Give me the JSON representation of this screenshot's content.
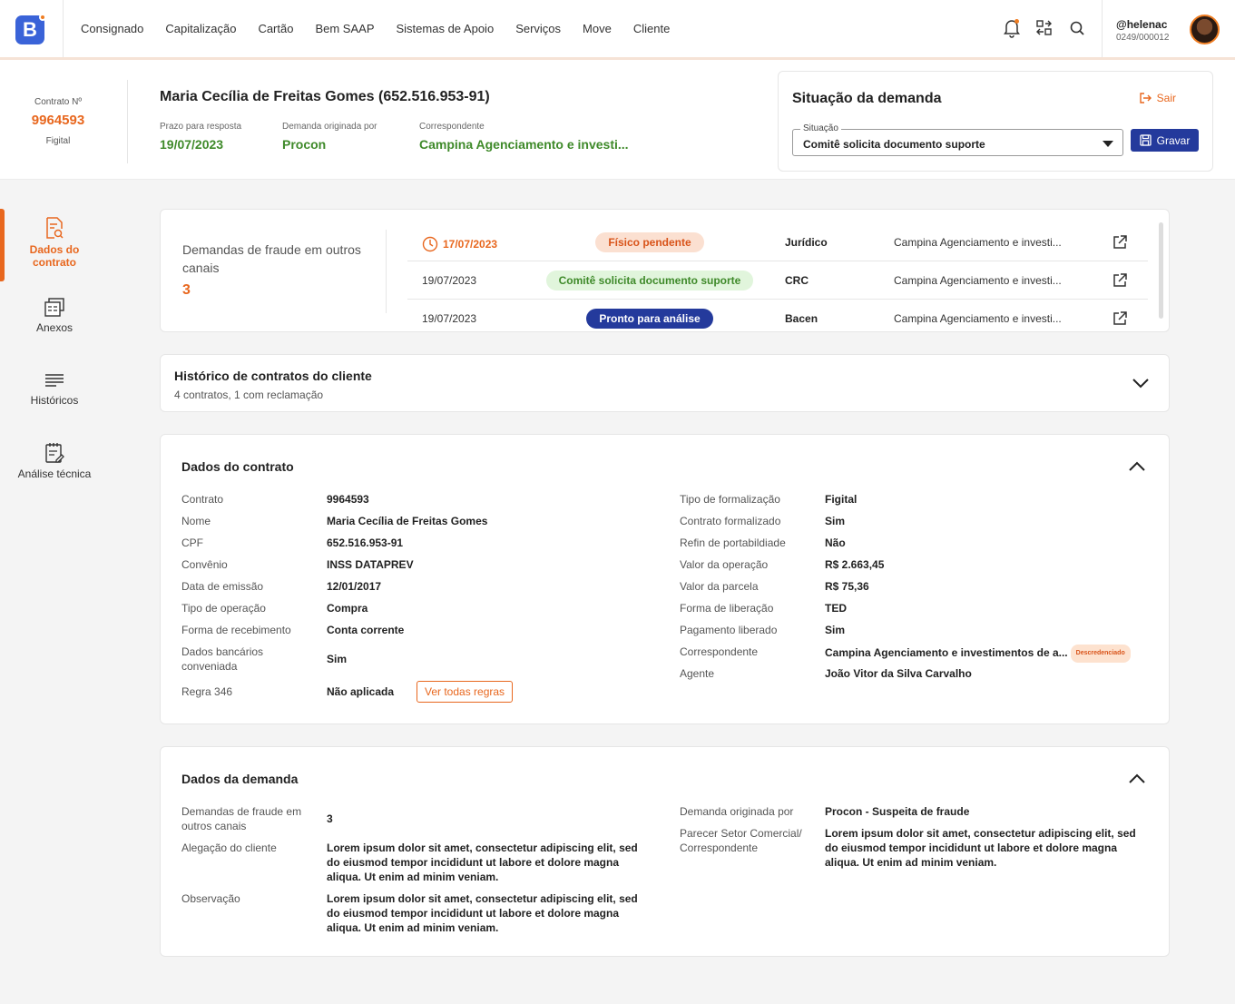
{
  "nav": {
    "logo_letter": "B",
    "items": [
      "Consignado",
      "Capitalização",
      "Cartão",
      "Bem SAAP",
      "Sistemas de Apoio",
      "Serviços",
      "Move",
      "Cliente"
    ],
    "user_name": "@helenac",
    "user_code": "0249/000012",
    "icons": [
      "bell-icon",
      "transfer-icon",
      "search-icon"
    ]
  },
  "header": {
    "contract_label": "Contrato Nº",
    "contract_number": "9964593",
    "contract_type": "Figital",
    "client_name": "Maria Cecília de Freitas Gomes (652.516.953-91)",
    "prazo_label": "Prazo para resposta",
    "prazo_value": "19/07/2023",
    "origem_label": "Demanda originada por",
    "origem_value": "Procon",
    "corr_label": "Correspondente",
    "corr_value": "Campina Agenciamento e investi..."
  },
  "situacao": {
    "title": "Situação da demanda",
    "sair_label": "Sair",
    "select_legend": "Situação",
    "select_value": "Comitê solicita documento suporte",
    "gravar_label": "Gravar"
  },
  "sidebar": {
    "items": [
      {
        "label_line1": "Dados do",
        "label_line2": "contrato",
        "icon": "document-search-icon"
      },
      {
        "label": "Anexos",
        "icon": "attachments-icon"
      },
      {
        "label": "Históricos",
        "icon": "list-lines-icon"
      },
      {
        "label": "Análise técnica",
        "icon": "clipboard-edit-icon"
      }
    ]
  },
  "fraud": {
    "title": "Demandas de fraude em outros canais",
    "count": "3",
    "rows": [
      {
        "date": "17/07/2023",
        "status": "Físico pendente",
        "area": "Jurídico",
        "corr": "Campina Agenciamento e investi..."
      },
      {
        "date": "19/07/2023",
        "status": "Comitê solicita documento suporte",
        "area": "CRC",
        "corr": "Campina Agenciamento e investi..."
      },
      {
        "date": "19/07/2023",
        "status": "Pronto para análise",
        "area": "Bacen",
        "corr": "Campina Agenciamento e investi..."
      }
    ],
    "colors": {
      "urgent": "#e8671e",
      "pendente_bg": "#fbe0d1",
      "comite_bg": "#e1f5dc",
      "pronto_bg": "#243a9c"
    }
  },
  "historico": {
    "title": "Histórico de contratos do cliente",
    "subtitle": "4 contratos, 1 com reclamação"
  },
  "dados_contrato": {
    "title": "Dados do contrato",
    "left": [
      {
        "label": "Contrato",
        "value": "9964593"
      },
      {
        "label": "Nome",
        "value": "Maria Cecília de Freitas Gomes"
      },
      {
        "label": "CPF",
        "value": "652.516.953-91"
      },
      {
        "label": "Convênio",
        "value": "INSS DATAPREV"
      },
      {
        "label": "Data de emissão",
        "value": "12/01/2017"
      },
      {
        "label": "Tipo de operação",
        "value": "Compra"
      },
      {
        "label": "Forma de recebimento",
        "value": "Conta corrente"
      },
      {
        "label": "Dados bancários conveniada",
        "value": "Sim"
      },
      {
        "label": "Regra 346",
        "value": "Não aplicada"
      }
    ],
    "ver_regras_label": "Ver todas regras",
    "right": [
      {
        "label": "Tipo de formalização",
        "value": "Figital"
      },
      {
        "label": "Contrato formalizado",
        "value": "Sim"
      },
      {
        "label": "Refin de portabildiade",
        "value": "Não"
      },
      {
        "label": "Valor da operação",
        "value": "R$ 2.663,45"
      },
      {
        "label": "Valor da parcela",
        "value": "R$ 75,36"
      },
      {
        "label": "Forma de liberação",
        "value": "TED"
      },
      {
        "label": "Pagamento liberado",
        "value": "Sim"
      },
      {
        "label": "Correspondente",
        "value": "Campina Agenciamento e investimentos de a..."
      },
      {
        "label": "Agente",
        "value": "João Vitor da Silva Carvalho"
      }
    ],
    "descredenciado_label": "Descredenciado"
  },
  "dados_demanda": {
    "title": "Dados da demanda",
    "fraude_label": "Demandas de fraude em outros canais",
    "fraude_value": "3",
    "alegacao_label": "Alegação do cliente",
    "alegacao_value": "Lorem ipsum dolor sit amet, consectetur adipiscing elit, sed do eiusmod tempor incididunt ut labore et dolore magna aliqua. Ut enim ad minim veniam.",
    "obs_label": "Observação",
    "obs_value": "Lorem ipsum dolor sit amet, consectetur adipiscing elit, sed do eiusmod tempor incididunt ut labore et dolore magna aliqua. Ut enim ad minim veniam.",
    "origem_label": "Demanda originada por",
    "origem_value": "Procon - Suspeita de fraude",
    "parecer_label": "Parecer Setor Comercial/ Correspondente",
    "parecer_value": "Lorem ipsum dolor sit amet, consectetur adipiscing elit, sed do eiusmod tempor incididunt ut labore et dolore magna aliqua. Ut enim ad minim veniam."
  }
}
